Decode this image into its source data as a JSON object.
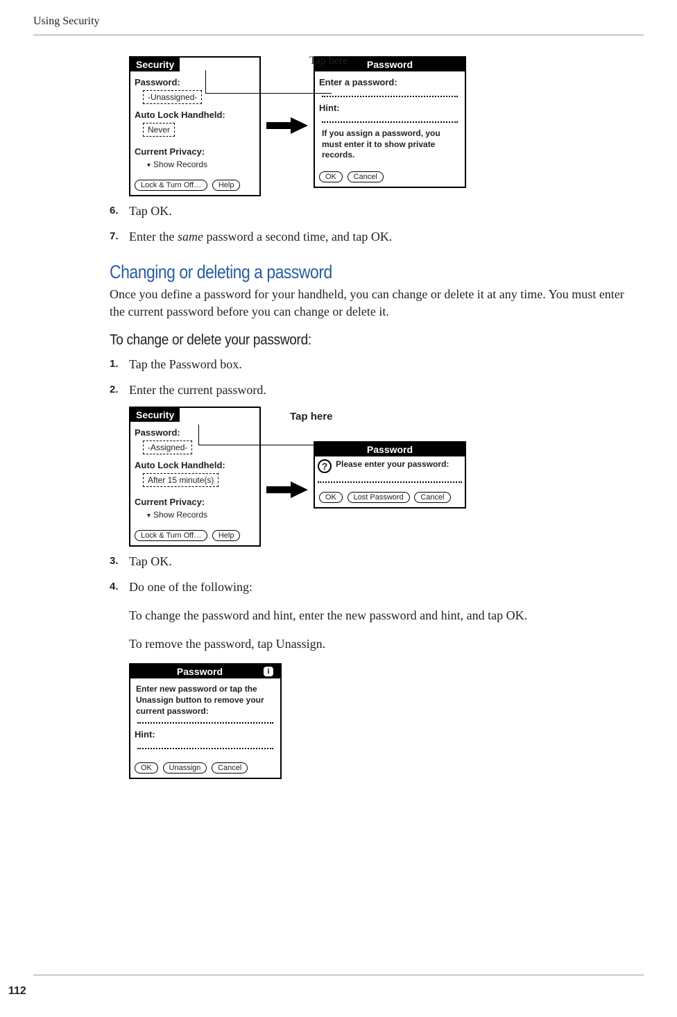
{
  "header": "Using Security",
  "page_number": "112",
  "fig1": {
    "tap_label": "Tap here",
    "security": {
      "title": "Security",
      "password_label": "Password:",
      "password_value": "-Unassigned-",
      "autolock_label": "Auto Lock Handheld:",
      "autolock_value": "Never",
      "privacy_label": "Current Privacy:",
      "privacy_value": "Show Records",
      "lock_btn": "Lock & Turn Off…",
      "help_btn": "Help"
    },
    "password": {
      "title": "Password",
      "enter_label": "Enter a password:",
      "hint_label": "Hint:",
      "note": "If you assign a password, you must enter it to show private records.",
      "ok_btn": "OK",
      "cancel_btn": "Cancel"
    }
  },
  "steps_a": {
    "s6_num": "6.",
    "s6_text": "Tap OK.",
    "s7_num": "7.",
    "s7_text_a": "Enter the ",
    "s7_text_em": "same",
    "s7_text_b": " password a second time, and tap OK."
  },
  "section": {
    "heading": "Changing or deleting a password",
    "para": "Once you define a password for your handheld, you can change or delete it at any time. You must enter the current password before you can change or delete it."
  },
  "sub": {
    "heading": "To change or delete your password:",
    "s1_num": "1.",
    "s1_text": "Tap the Password box.",
    "s2_num": "2.",
    "s2_text": "Enter the current password."
  },
  "fig2": {
    "tap_label": "Tap here",
    "security": {
      "title": "Security",
      "password_label": "Password:",
      "password_value": "-Assigned-",
      "autolock_label": "Auto Lock Handheld:",
      "autolock_value": "After 15 minute(s)",
      "privacy_label": "Current Privacy:",
      "privacy_value": "Show Records",
      "lock_btn": "Lock & Turn Off…",
      "help_btn": "Help"
    },
    "password": {
      "title": "Password",
      "prompt": "Please enter your password:",
      "ok_btn": "OK",
      "lost_btn": "Lost Password",
      "cancel_btn": "Cancel"
    }
  },
  "steps_b": {
    "s3_num": "3.",
    "s3_text": "Tap OK.",
    "s4_num": "4.",
    "s4_text": "Do one of the following:",
    "s4_p1": "To change the password and hint, enter the new password and hint, and tap OK.",
    "s4_p2": "To remove the password, tap Unassign."
  },
  "fig3": {
    "title": "Password",
    "info": "i",
    "prompt": "Enter new password or tap the Unassign button to remove your current password:",
    "hint_label": "Hint:",
    "ok_btn": "OK",
    "unassign_btn": "Unassign",
    "cancel_btn": "Cancel"
  }
}
